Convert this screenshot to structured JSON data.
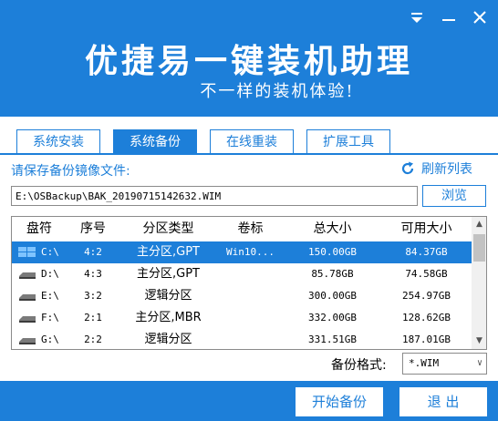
{
  "window": {
    "title": "优捷易一键装机助理",
    "subtitle": "不一样的装机体验!"
  },
  "tabs": [
    {
      "label": "系统安装",
      "active": false
    },
    {
      "label": "系统备份",
      "active": true
    },
    {
      "label": "在线重装",
      "active": false
    },
    {
      "label": "扩展工具",
      "active": false
    }
  ],
  "backup": {
    "prompt": "请保存备份镜像文件:",
    "refresh_label": "刷新列表",
    "path_value": "E:\\OSBackup\\BAK_20190715142632.WIM",
    "browse_label": "浏览"
  },
  "table": {
    "columns": [
      "盘符",
      "序号",
      "分区类型",
      "卷标",
      "总大小",
      "可用大小"
    ],
    "rows": [
      {
        "drive": "C:\\",
        "index": "4:2",
        "type": "主分区,GPT",
        "label": "Win10...",
        "total": "150.00GB",
        "free": "84.37GB",
        "selected": true
      },
      {
        "drive": "D:\\",
        "index": "4:3",
        "type": "主分区,GPT",
        "label": "",
        "total": "85.78GB",
        "free": "74.58GB",
        "selected": false
      },
      {
        "drive": "E:\\",
        "index": "3:2",
        "type": "逻辑分区",
        "label": "",
        "total": "300.00GB",
        "free": "254.97GB",
        "selected": false
      },
      {
        "drive": "F:\\",
        "index": "2:1",
        "type": "主分区,MBR",
        "label": "",
        "total": "332.00GB",
        "free": "128.62GB",
        "selected": false
      },
      {
        "drive": "G:\\",
        "index": "2:2",
        "type": "逻辑分区",
        "label": "",
        "total": "331.51GB",
        "free": "187.01GB",
        "selected": false
      }
    ]
  },
  "format": {
    "label": "备份格式:",
    "value": "*.WIM"
  },
  "footer": {
    "start_label": "开始备份",
    "exit_label": "退 出"
  },
  "colors": {
    "accent": "#1d7fd9"
  }
}
